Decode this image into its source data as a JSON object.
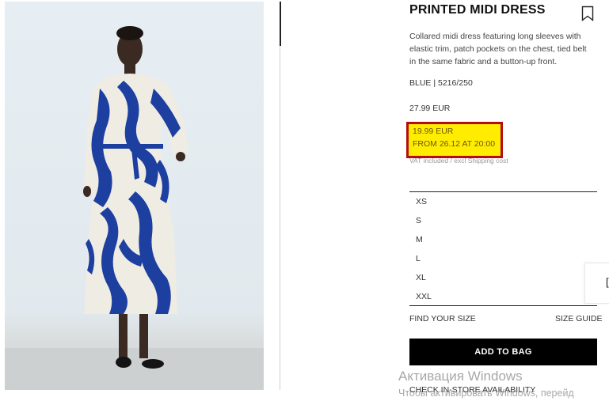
{
  "product": {
    "title": "PRINTED MIDI DRESS",
    "description": "Collared midi dress featuring long sleeves with elastic trim, patch pockets on the chest, tied belt in the same fabric and a button-up front.",
    "color_ref": "BLUE | 5216/250",
    "old_price": "27.99 EUR",
    "sale_price": "19.99 EUR",
    "sale_from": "FROM 26.12 AT 20:00",
    "vat_note": "VAT included / excl Shipping cost",
    "image_icon": "dress-photo",
    "print_colors": {
      "primary": "#1d3fa0",
      "base": "#efece4"
    }
  },
  "sizes": [
    "XS",
    "S",
    "M",
    "L",
    "XL",
    "XXL"
  ],
  "links": {
    "find_size": "FIND YOUR SIZE",
    "size_guide": "SIZE GUIDE",
    "store_availability": "CHECK IN-STORE AVAILABILITY"
  },
  "actions": {
    "add_to_bag": "ADD TO BAG"
  },
  "side_tab": {
    "label": "["
  },
  "highlight": {
    "border_color": "#b30d12",
    "fill_color": "#ffec00"
  },
  "watermark": {
    "line1": "Активация Windows",
    "line2": "Чтобы активировать Windows, перейд"
  }
}
